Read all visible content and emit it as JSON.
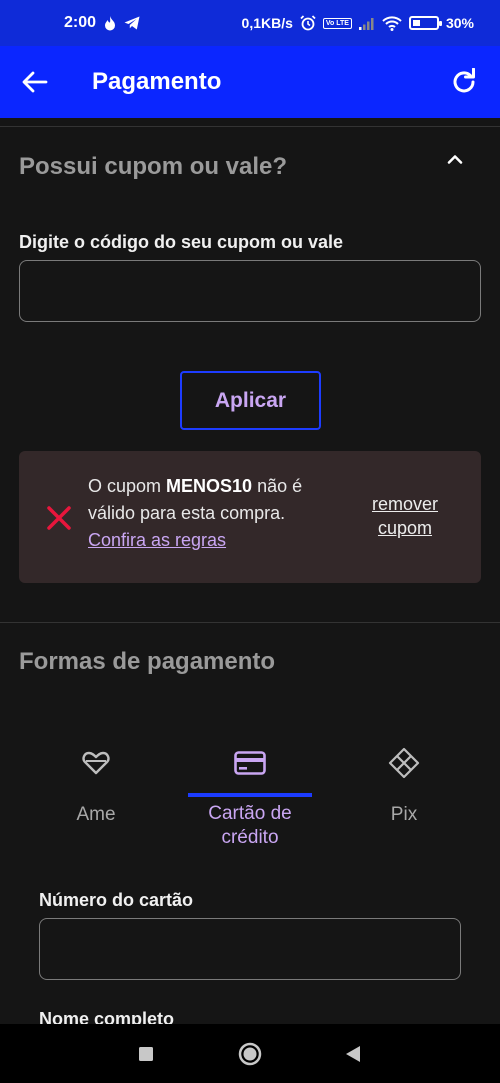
{
  "status_bar": {
    "time": "2:00",
    "network_speed": "0,1KB/s",
    "volte": "Vo LTE",
    "battery": "30%",
    "battery_level": 0.3
  },
  "app_bar": {
    "title": "Pagamento"
  },
  "coupon": {
    "title": "Possui cupom ou vale?",
    "input_label": "Digite o código do seu cupom ou vale",
    "input_value": "",
    "apply_label": "Aplicar",
    "error": {
      "prefix": "O cupom ",
      "code": "MENOS10",
      "suffix": " não é válido para esta compra.",
      "rules_link": "Confira as regras",
      "remove_link": "remover cupom"
    }
  },
  "payment": {
    "title": "Formas de pagamento",
    "tabs": [
      {
        "label": "Ame",
        "icon": "ame-heart-icon",
        "active": false
      },
      {
        "label": "Cartão de crédito",
        "icon": "credit-card-icon",
        "active": true
      },
      {
        "label": "Pix",
        "icon": "pix-icon",
        "active": false
      }
    ],
    "card_number_label": "Número do cartão",
    "card_number_value": "",
    "full_name_label": "Nome completo"
  },
  "colors": {
    "primary_blue": "#0b26ff",
    "accent_purple": "#c9a6f2",
    "error_red": "#e8163c",
    "background": "#151515"
  }
}
